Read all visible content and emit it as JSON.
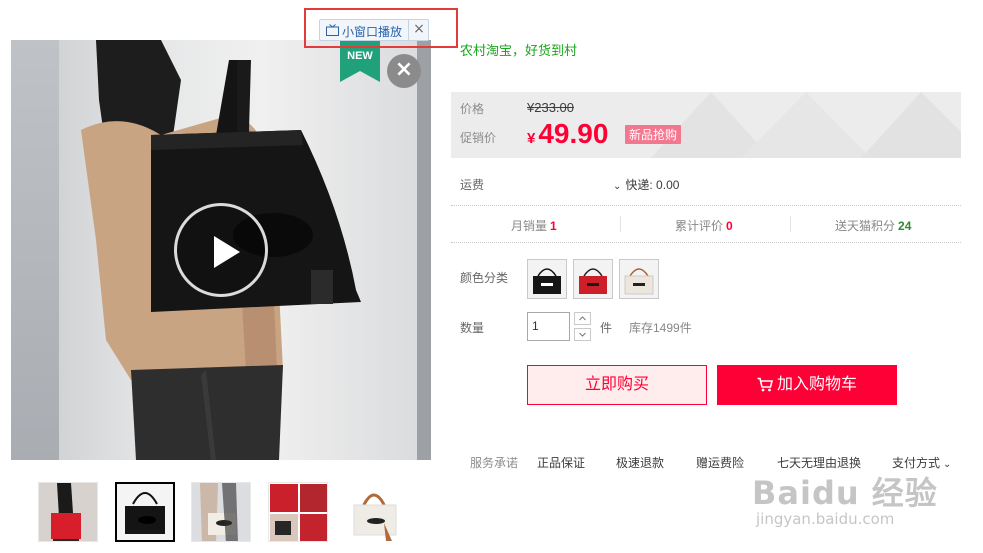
{
  "mini_player": {
    "label": "小窗口播放",
    "close": "×"
  },
  "badge_new": "NEW",
  "close_video": "×",
  "slogan": "农村淘宝，好货到村",
  "price": {
    "label": "价格",
    "original_currency": "¥",
    "original_value": "233.00",
    "promo_label": "促销价",
    "promo_currency": "¥",
    "promo_value": "49.90",
    "promo_badge": "新品抢购"
  },
  "shipping": {
    "label": "运费",
    "value": "快递: 0.00"
  },
  "stats": {
    "monthly_sales_label": "月销量",
    "monthly_sales_value": "1",
    "reviews_label": "累计评价",
    "reviews_value": "0",
    "points_label": "送天猫积分",
    "points_value": "24"
  },
  "color": {
    "label": "颜色分类"
  },
  "quantity": {
    "label": "数量",
    "value": "1",
    "unit": "件",
    "stock": "库存1499件"
  },
  "buttons": {
    "buy_now": "立即购买",
    "add_to_cart": "加入购物车"
  },
  "services": {
    "label": "服务承诺",
    "items": [
      "正品保证",
      "极速退款",
      "赠运费险",
      "七天无理由退换"
    ],
    "payment": "支付方式"
  },
  "watermark": {
    "main": "Baidu 经验",
    "url": "jingyan.baidu.com"
  },
  "colors": {
    "accent": "#ff0036",
    "green_slogan": "#17a51a",
    "badge_pink": "#f3788f",
    "highlight_red": "#e23b3b"
  }
}
